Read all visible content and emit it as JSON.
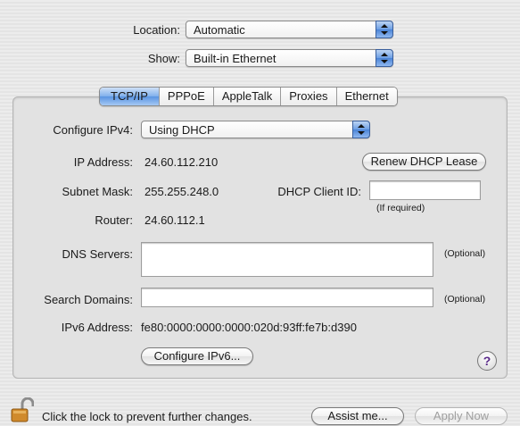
{
  "location": {
    "label": "Location:",
    "value": "Automatic"
  },
  "show": {
    "label": "Show:",
    "value": "Built-in Ethernet"
  },
  "tabs": [
    {
      "label": "TCP/IP",
      "active": true
    },
    {
      "label": "PPPoE",
      "active": false
    },
    {
      "label": "AppleTalk",
      "active": false
    },
    {
      "label": "Proxies",
      "active": false
    },
    {
      "label": "Ethernet",
      "active": false
    }
  ],
  "tcpip": {
    "configure_ipv4": {
      "label": "Configure IPv4:",
      "value": "Using DHCP"
    },
    "ip_address": {
      "label": "IP Address:",
      "value": "24.60.112.210"
    },
    "renew_button": "Renew DHCP Lease",
    "subnet_mask": {
      "label": "Subnet Mask:",
      "value": "255.255.248.0"
    },
    "dhcp_client_id": {
      "label": "DHCP Client ID:",
      "value": "",
      "hint": "(If required)"
    },
    "router": {
      "label": "Router:",
      "value": "24.60.112.1"
    },
    "dns_servers": {
      "label": "DNS Servers:",
      "value": "",
      "hint": "(Optional)"
    },
    "search_domains": {
      "label": "Search Domains:",
      "value": "",
      "hint": "(Optional)"
    },
    "ipv6_address": {
      "label": "IPv6 Address:",
      "value": "fe80:0000:0000:0000:020d:93ff:fe7b:d390"
    },
    "configure_ipv6_button": "Configure IPv6...",
    "help": "?"
  },
  "footer": {
    "lock_text": "Click the lock to prevent further changes.",
    "assist_button": "Assist me...",
    "apply_button": "Apply Now"
  },
  "colors": {
    "accent": "#5a94e2",
    "help_glyph": "#5a2a8a"
  }
}
